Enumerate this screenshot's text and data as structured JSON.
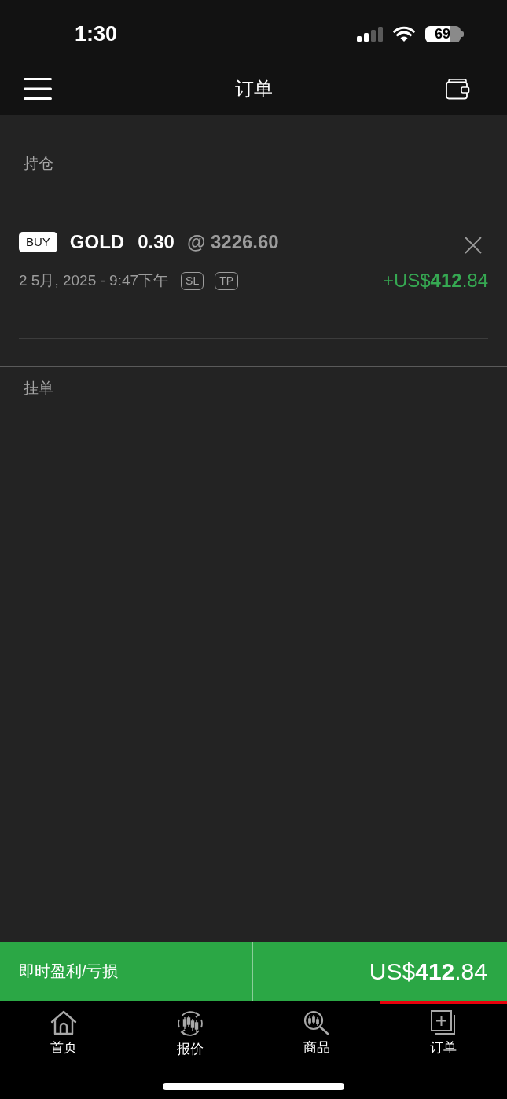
{
  "status_bar": {
    "time": "1:30",
    "battery": "69"
  },
  "header": {
    "title": "订单"
  },
  "sections": [
    {
      "title": "持仓",
      "positions": [
        {
          "side": "BUY",
          "symbol": "GOLD",
          "volume": "0.30",
          "price": "@ 3226.60",
          "opened": "2 5月, 2025 - 9:47下午",
          "tags": [
            "SL",
            "TP"
          ],
          "profit": "+US$**412**.84"
        }
      ]
    },
    {
      "title": "挂单"
    }
  ],
  "summary": {
    "label": "即时盈利/亏损",
    "value": "US$**412**.84"
  },
  "tabs": [
    {
      "label": "首页",
      "selected": false
    },
    {
      "label": "报价",
      "selected": false
    },
    {
      "label": "商品",
      "selected": false
    },
    {
      "label": "订单",
      "selected": true
    }
  ]
}
